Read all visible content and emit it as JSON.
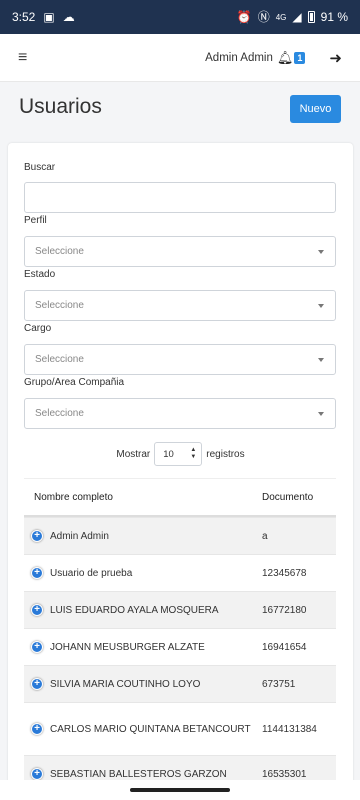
{
  "status_bar": {
    "time": "3:52",
    "battery": "91 %",
    "network": "4G"
  },
  "topbar": {
    "user_name": "Admin Admin",
    "notif_count": "1"
  },
  "page": {
    "title": "Usuarios",
    "new_button": "Nuevo"
  },
  "filters": {
    "search_label": "Buscar",
    "search_value": "",
    "profile_label": "Perfil",
    "profile_value": "Seleccione",
    "state_label": "Estado",
    "state_value": "Seleccione",
    "position_label": "Cargo",
    "position_value": "Seleccione",
    "group_label": "Grupo/Area Compañia",
    "group_value": "Seleccione"
  },
  "pagination": {
    "show_label": "Mostrar",
    "page_size": "10",
    "records_label": "registros"
  },
  "table": {
    "headers": {
      "name": "Nombre completo",
      "document": "Documento"
    },
    "rows": [
      {
        "name": "Admin Admin",
        "document": "a"
      },
      {
        "name": "Usuario de prueba",
        "document": "12345678"
      },
      {
        "name": "LUIS EDUARDO AYALA MOSQUERA",
        "document": "16772180"
      },
      {
        "name": "JOHANN MEUSBURGER ALZATE",
        "document": "16941654"
      },
      {
        "name": "SILVIA MARIA COUTINHO LOYO",
        "document": "673751"
      },
      {
        "name": "CARLOS MARIO QUINTANA BETANCOURT",
        "document": "1144131384"
      },
      {
        "name": "SEBASTIAN BALLESTEROS GARZON",
        "document": "16535301"
      }
    ]
  },
  "colors": {
    "primary": "#2a8ae0",
    "status_bar": "#1f3250"
  }
}
